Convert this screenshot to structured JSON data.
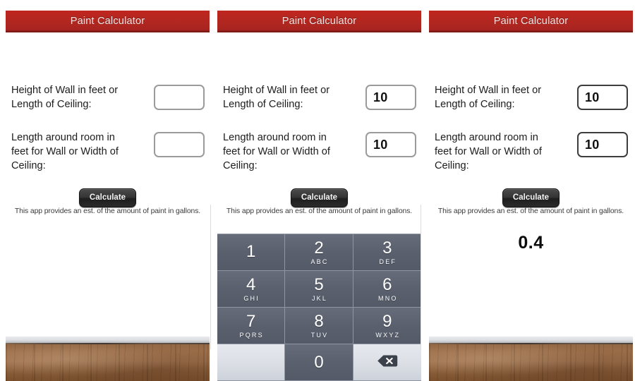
{
  "app": {
    "title": "Paint Calculator",
    "accent_color": "#b22720",
    "keypad_color": "#5b616e",
    "key_light_color": "#dcdfe6"
  },
  "form": {
    "field1": {
      "label": "Height of Wall in feet or Length of Ceiling:",
      "empty_value": "",
      "filled_value": "10"
    },
    "field2": {
      "label": "Length around room in feet for Wall or Width of Ceiling:",
      "empty_value": "",
      "filled_value": "10"
    },
    "calculate_label": "Calculate",
    "disclaimer": "This app provides an est. of the amount of paint in gallons."
  },
  "result": {
    "value": "0.4"
  },
  "keypad": {
    "keys": [
      {
        "num": "1",
        "sub": ""
      },
      {
        "num": "2",
        "sub": "ABC"
      },
      {
        "num": "3",
        "sub": "DEF"
      },
      {
        "num": "4",
        "sub": "GHI"
      },
      {
        "num": "5",
        "sub": "JKL"
      },
      {
        "num": "6",
        "sub": "MNO"
      },
      {
        "num": "7",
        "sub": "PQRS"
      },
      {
        "num": "8",
        "sub": "TUV"
      },
      {
        "num": "9",
        "sub": "WXYZ"
      },
      {
        "num": "",
        "sub": ""
      },
      {
        "num": "0",
        "sub": ""
      },
      {
        "num": "",
        "sub": "",
        "icon": "backspace-icon"
      }
    ]
  },
  "panels": [
    {
      "state": "empty"
    },
    {
      "state": "keypad-open"
    },
    {
      "state": "result-shown"
    }
  ]
}
